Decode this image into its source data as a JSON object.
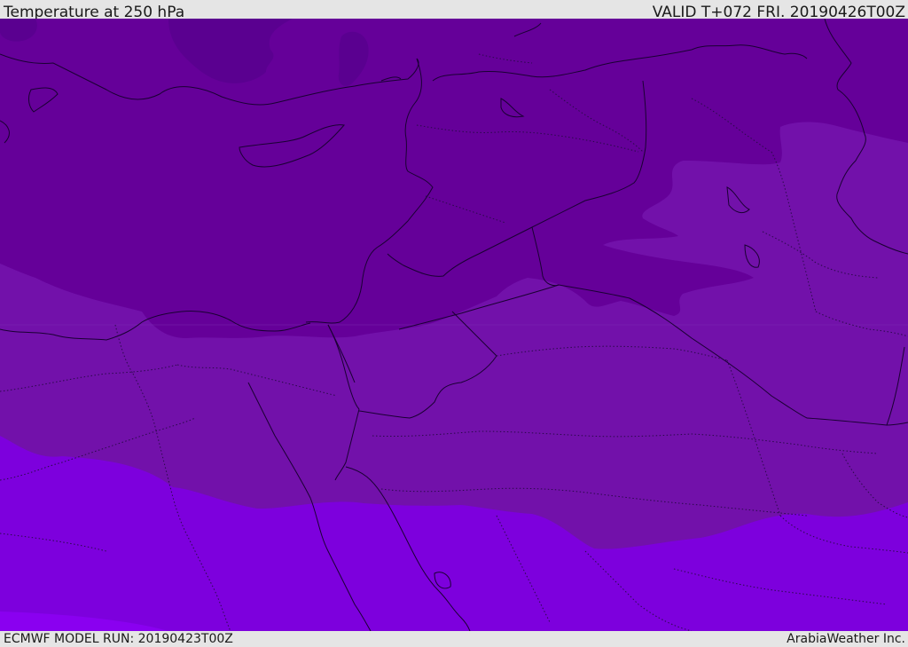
{
  "header": {
    "title": "Temperature at 250 hPa",
    "valid_time": "VALID T+072 FRI. 20190426T00Z"
  },
  "footer": {
    "model_run": "ECMWF MODEL RUN: 20190423T00Z",
    "credit": "ArabiaWeather Inc."
  },
  "colors": {
    "band_coldest": "#5a0090",
    "band_cold": "#650099",
    "band_mid": "#7211aa",
    "band_warm": "#7d00dd",
    "band_warmest": "#8a00f0",
    "coastline": "#1a0033"
  }
}
